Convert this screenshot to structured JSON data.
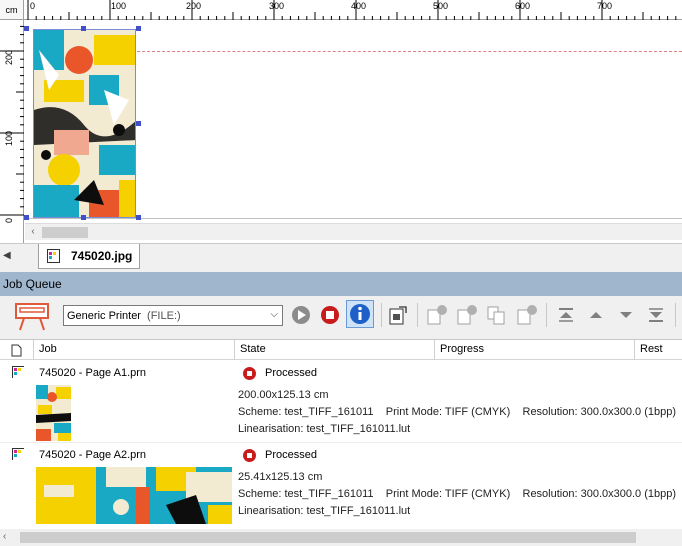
{
  "ruler": {
    "unit": "cm",
    "h_labels": [
      "0",
      "100",
      "200",
      "300",
      "400",
      "500",
      "600",
      "700"
    ],
    "v_labels": [
      "200",
      "100",
      "0"
    ]
  },
  "document_tab": {
    "label": "745020.jpg"
  },
  "job_queue": {
    "title": "Job Queue",
    "printer": {
      "name": "Generic Printer",
      "port": "(FILE:)"
    },
    "columns": {
      "job": "Job",
      "state": "State",
      "progress": "Progress",
      "rest": "Rest"
    },
    "jobs": [
      {
        "name": "745020 - Page A1.prn",
        "state": "Processed",
        "dimensions": "200.00x125.13 cm",
        "scheme": "Scheme: test_TIFF_161011",
        "print_mode": "Print Mode: TIFF (CMYK)",
        "resolution": "Resolution: 300.0x300.0 (1bpp)",
        "linearisation": "Linearisation: test_TIFF_161011.lut"
      },
      {
        "name": "745020 - Page A2.prn",
        "state": "Processed",
        "dimensions": "25.41x125.13 cm",
        "scheme": "Scheme: test_TIFF_161011",
        "print_mode": "Print Mode: TIFF (CMYK)",
        "resolution": "Resolution: 300.0x300.0 (1bpp)",
        "linearisation": "Linearisation: test_TIFF_161011.lut"
      }
    ]
  },
  "colors": {
    "queue_header": "#9fb6cd",
    "stop_red": "#c81c1c",
    "info_blue": "#1e5fc8",
    "selection_handle": "#4050c8"
  }
}
